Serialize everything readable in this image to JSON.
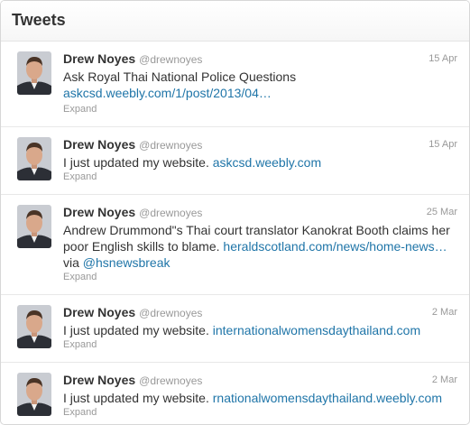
{
  "header": {
    "title": "Tweets"
  },
  "tweets": [
    {
      "name": "Drew Noyes",
      "handle": "@drewnoyes",
      "time": "15 Apr",
      "text": "Ask Royal Thai National Police Questions",
      "link": "askcsd.weebly.com/1/post/2013/04…",
      "expand": "Expand"
    },
    {
      "name": "Drew Noyes",
      "handle": "@drewnoyes",
      "time": "15 Apr",
      "text": "I just updated my website.",
      "link": "askcsd.weebly.com",
      "expand": "Expand"
    },
    {
      "name": "Drew Noyes",
      "handle": "@drewnoyes",
      "time": "25 Mar",
      "text": "Andrew Drummond\"s Thai court translator Kanokrat Booth claims her poor English skills to blame.",
      "link": "heraldscotland.com/news/home-news…",
      "via": "via",
      "mention": "@hsnewsbreak",
      "expand": "Expand"
    },
    {
      "name": "Drew Noyes",
      "handle": "@drewnoyes",
      "time": "2 Mar",
      "text": "I just updated my website.",
      "link": "internationalwomensdaythailand.com",
      "expand": "Expand"
    },
    {
      "name": "Drew Noyes",
      "handle": "@drewnoyes",
      "time": "2 Mar",
      "text": "I just updated my website.",
      "link": "rnationalwomensdaythailand.weebly.com",
      "expand": "Expand"
    }
  ]
}
